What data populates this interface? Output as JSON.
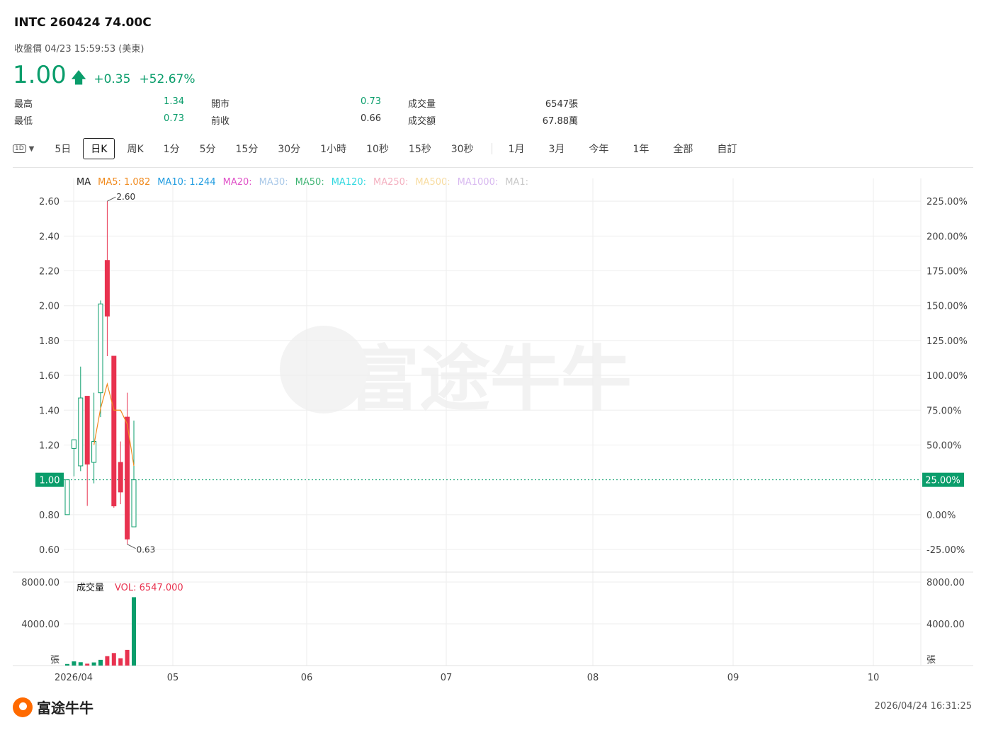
{
  "header": {
    "title": "INTC 260424 74.00C",
    "subtitle": "收盤價 04/23 15:59:53 (美東)",
    "price": "1.00",
    "change": "+0.35",
    "change_pct": "+52.67%"
  },
  "stats": [
    {
      "label": "最高",
      "value": "1.34",
      "color": "green"
    },
    {
      "label": "開市",
      "value": "0.73",
      "color": "green"
    },
    {
      "label": "成交量",
      "value": "6547張",
      "color": "grey"
    },
    {
      "label": "最低",
      "value": "0.73",
      "color": "green"
    },
    {
      "label": "前收",
      "value": "0.66",
      "color": "grey"
    },
    {
      "label": "成交額",
      "value": "67.88萬",
      "color": "grey"
    }
  ],
  "toolbar": {
    "interval_icon": "1D",
    "timeframes": [
      "5日",
      "日K",
      "周K",
      "1分",
      "5分",
      "15分",
      "30分",
      "1小時",
      "10秒",
      "15秒",
      "30秒"
    ],
    "ranges": [
      "1月",
      "3月",
      "今年",
      "1年",
      "全部",
      "自訂"
    ],
    "active": "日K"
  },
  "ma_legend": [
    {
      "text": "MA",
      "color": "#222222"
    },
    {
      "text": "MA5: 1.082",
      "color": "#f08a1e"
    },
    {
      "text": "MA10: 1.244",
      "color": "#1e9be0"
    },
    {
      "text": "MA20:",
      "color": "#e052c8"
    },
    {
      "text": "MA30:",
      "color": "#a8c8e8"
    },
    {
      "text": "MA50:",
      "color": "#3cb371"
    },
    {
      "text": "MA120:",
      "color": "#30d8e0"
    },
    {
      "text": "MA250:",
      "color": "#f4b0c0"
    },
    {
      "text": "MA500:",
      "color": "#f8dca0"
    },
    {
      "text": "MA1000:",
      "color": "#d8b8f0"
    },
    {
      "text": "MA1:",
      "color": "#c8c8c8"
    }
  ],
  "watermark": "富途牛牛",
  "chart_data": {
    "type": "candlestick",
    "y_left_ticks": [
      "2.60",
      "2.40",
      "2.20",
      "2.00",
      "1.80",
      "1.60",
      "1.40",
      "1.20",
      "0.80",
      "0.60"
    ],
    "y_right_ticks": [
      "225.00%",
      "200.00%",
      "175.00%",
      "150.00%",
      "125.00%",
      "100.00%",
      "75.00%",
      "50.00%",
      "0.00%",
      "-25.00%"
    ],
    "ylim": [
      0.47,
      2.69
    ],
    "current_price_label": "1.00",
    "current_pct_label": "25.00%",
    "high_annotation": "2.60",
    "low_annotation": "0.63",
    "x_tick_labels": [
      "2026/04",
      "05",
      "06",
      "07",
      "08",
      "09",
      "10"
    ],
    "candles": [
      {
        "open": 0.8,
        "close": 1.0,
        "high": 1.0,
        "low": 0.8
      },
      {
        "open": 1.18,
        "close": 1.23,
        "high": 1.23,
        "low": 1.02
      },
      {
        "open": 1.08,
        "close": 1.47,
        "high": 1.65,
        "low": 1.05
      },
      {
        "open": 1.48,
        "close": 1.09,
        "high": 1.48,
        "low": 0.85
      },
      {
        "open": 1.1,
        "close": 1.22,
        "high": 1.5,
        "low": 0.98
      },
      {
        "open": 1.5,
        "close": 2.01,
        "high": 2.03,
        "low": 1.36
      },
      {
        "open": 2.26,
        "close": 1.94,
        "high": 2.6,
        "low": 1.71
      },
      {
        "open": 1.71,
        "close": 0.85,
        "high": 1.71,
        "low": 0.84
      },
      {
        "open": 1.1,
        "close": 0.93,
        "high": 1.22,
        "low": 0.86
      },
      {
        "open": 1.36,
        "close": 0.66,
        "high": 1.5,
        "low": 0.63
      },
      {
        "open": 0.73,
        "close": 1.0,
        "high": 1.34,
        "low": 0.73
      }
    ],
    "ma5": [
      null,
      null,
      null,
      null,
      1.2,
      1.41,
      1.55,
      1.4,
      1.4,
      1.32,
      1.08
    ],
    "volume": {
      "title": "成交量",
      "label": "VOL: 6547.000",
      "unit": "張",
      "y_ticks": [
        "8000.00",
        "4000.00"
      ],
      "ylim": [
        0,
        8000
      ],
      "values": [
        150,
        400,
        320,
        180,
        300,
        550,
        900,
        1200,
        700,
        1500,
        6547
      ]
    }
  }
}
